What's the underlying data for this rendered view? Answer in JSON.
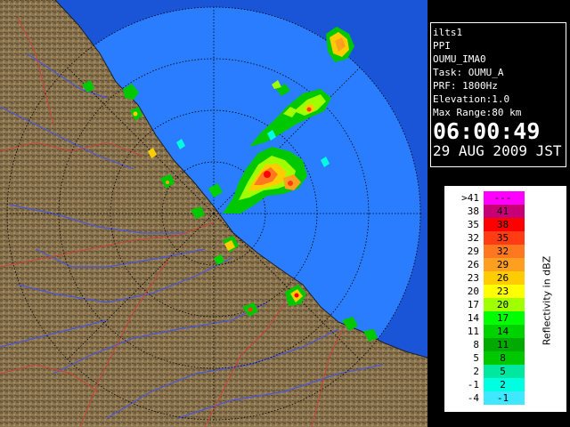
{
  "info": {
    "site": "ilts1",
    "scan_type": "PPI",
    "product": "OUMU_IMA0",
    "task": "Task: OUMU_A",
    "prf": "PRF: 1800Hz",
    "elevation": "Elevation:1.0",
    "max_range": "Max Range:80 km",
    "time": "06:00:49",
    "date": "29 AUG 2009 JST"
  },
  "legend": {
    "axis_label": "Reflectivity in dBZ",
    "rows": [
      {
        "lo": ">41",
        "hi": "---",
        "color": "#ff00ff"
      },
      {
        "lo": "38",
        "hi": "41",
        "color": "#c80078"
      },
      {
        "lo": "35",
        "hi": "38",
        "color": "#ff0000"
      },
      {
        "lo": "32",
        "hi": "35",
        "color": "#ff3c14"
      },
      {
        "lo": "29",
        "hi": "32",
        "color": "#ff7820"
      },
      {
        "lo": "26",
        "hi": "29",
        "color": "#ff9f20"
      },
      {
        "lo": "23",
        "hi": "26",
        "color": "#ffcc00"
      },
      {
        "lo": "20",
        "hi": "23",
        "color": "#ffff00"
      },
      {
        "lo": "17",
        "hi": "20",
        "color": "#a0ff00"
      },
      {
        "lo": "14",
        "hi": "17",
        "color": "#00ff00"
      },
      {
        "lo": "11",
        "hi": "14",
        "color": "#00d200"
      },
      {
        "lo": "8",
        "hi": "11",
        "color": "#00aa00"
      },
      {
        "lo": "5",
        "hi": "8",
        "color": "#00c800"
      },
      {
        "lo": "2",
        "hi": "5",
        "color": "#00e8a0"
      },
      {
        "lo": "-1",
        "hi": "2",
        "color": "#00ffe0"
      },
      {
        "lo": "-4",
        "hi": "-1",
        "color": "#40e8ff"
      }
    ]
  },
  "colors": {
    "sea": "#1e78ff",
    "radar_disk": "#2a7dff",
    "outer_sea": "#1a55d8",
    "land": "#8c7650",
    "rivers": "#4a58d8",
    "borders": "#c8443a",
    "range_rings": "#000000"
  }
}
